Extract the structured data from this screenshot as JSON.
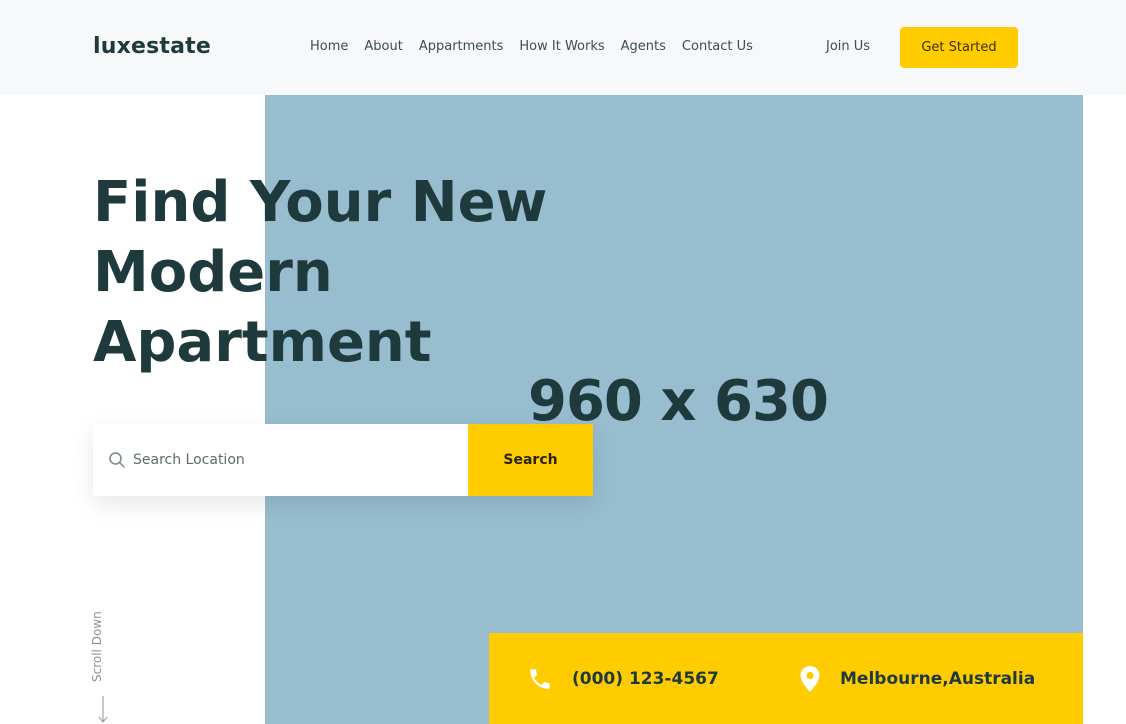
{
  "brand": {
    "name": "luxestate"
  },
  "nav": {
    "items": [
      {
        "label": "Home"
      },
      {
        "label": "About"
      },
      {
        "label": "Appartments"
      },
      {
        "label": "How It Works"
      },
      {
        "label": "Agents"
      },
      {
        "label": "Contact Us"
      }
    ],
    "join_label": "Join Us",
    "cta_label": "Get Started"
  },
  "hero": {
    "headline": "Find Your New Modern Apartment",
    "image_caption": "960 x 630"
  },
  "search": {
    "placeholder": "Search Location",
    "value": "",
    "button_label": "Search"
  },
  "scroll": {
    "label": "Scroll Down"
  },
  "contact": {
    "phone": "(000) 123-4567",
    "location": "Melbourne,Australia"
  },
  "colors": {
    "accent": "#ffcc00",
    "image_placeholder": "#97bdcf",
    "heading": "#1f3a3d",
    "header_bg": "#f7f8fa"
  },
  "icons": {
    "search": "search-icon",
    "phone": "phone-icon",
    "location": "map-pin-icon",
    "arrow": "arrow-down-icon"
  }
}
